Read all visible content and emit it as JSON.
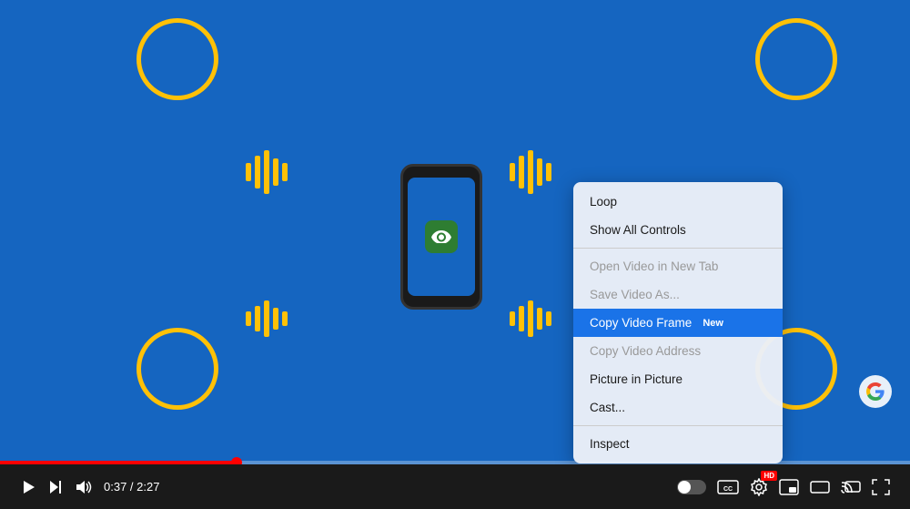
{
  "video": {
    "background_color": "#1565C0",
    "time_current": "0:37",
    "time_total": "2:27",
    "progress_percent": 26
  },
  "context_menu": {
    "items": [
      {
        "id": "loop",
        "label": "Loop",
        "disabled": false,
        "active": false,
        "new": false,
        "divider_before": false
      },
      {
        "id": "show-all-controls",
        "label": "Show All Controls",
        "disabled": false,
        "active": false,
        "new": false,
        "divider_before": false
      },
      {
        "id": "open-video-new-tab",
        "label": "Open Video in New Tab",
        "disabled": true,
        "active": false,
        "new": false,
        "divider_before": true
      },
      {
        "id": "save-video-as",
        "label": "Save Video As...",
        "disabled": true,
        "active": false,
        "new": false,
        "divider_before": false
      },
      {
        "id": "copy-video-frame",
        "label": "Copy Video Frame",
        "disabled": false,
        "active": true,
        "new": true,
        "divider_before": false
      },
      {
        "id": "copy-video-address",
        "label": "Copy Video Address",
        "disabled": true,
        "active": false,
        "new": false,
        "divider_before": false
      },
      {
        "id": "picture-in-picture",
        "label": "Picture in Picture",
        "disabled": false,
        "active": false,
        "new": false,
        "divider_before": false
      },
      {
        "id": "cast",
        "label": "Cast...",
        "disabled": false,
        "active": false,
        "new": false,
        "divider_before": false
      },
      {
        "id": "inspect",
        "label": "Inspect",
        "disabled": false,
        "active": false,
        "new": false,
        "divider_before": true
      }
    ]
  },
  "controls": {
    "play_label": "▶",
    "next_label": "⏭",
    "volume_label": "🔊",
    "time": "0:37 / 2:27",
    "cc_label": "CC",
    "new_badge": "New"
  }
}
